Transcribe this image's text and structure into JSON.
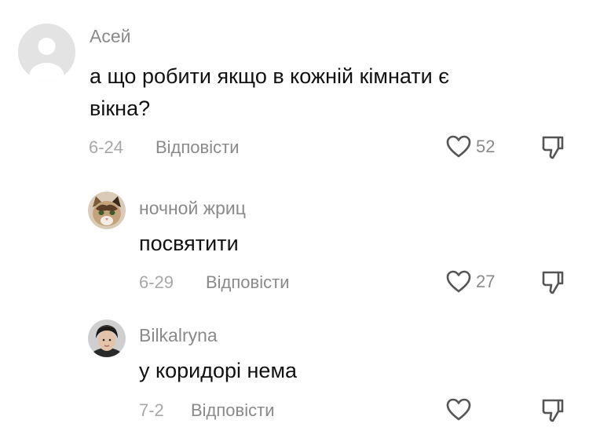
{
  "comments": [
    {
      "author": "Асей",
      "text_lines": [
        "а що робити якщо в кожній кімнати є",
        "вікна?"
      ],
      "date": "6-24",
      "reply_label": "Відповісти",
      "likes": "52",
      "avatar_icon": "default-user-icon",
      "avatar_bg": "#e3e3e3"
    },
    {
      "author": "ночной жриц",
      "text": "посвятити",
      "date": "6-29",
      "reply_label": "Відповісти",
      "likes": "27",
      "avatar_icon": "cat-photo-avatar"
    },
    {
      "author": "Bilkalryna",
      "text": "у коридорі нема",
      "date": "7-2",
      "reply_label": "Відповісти",
      "likes": "",
      "avatar_icon": "person-photo-avatar"
    }
  ],
  "icons": {
    "like": "heart-outline-icon",
    "dislike": "thumbs-down-outline-icon"
  },
  "colors": {
    "secondary_text": "#8a8a8a",
    "primary_text": "#111111",
    "icon_stroke": "#555555"
  }
}
